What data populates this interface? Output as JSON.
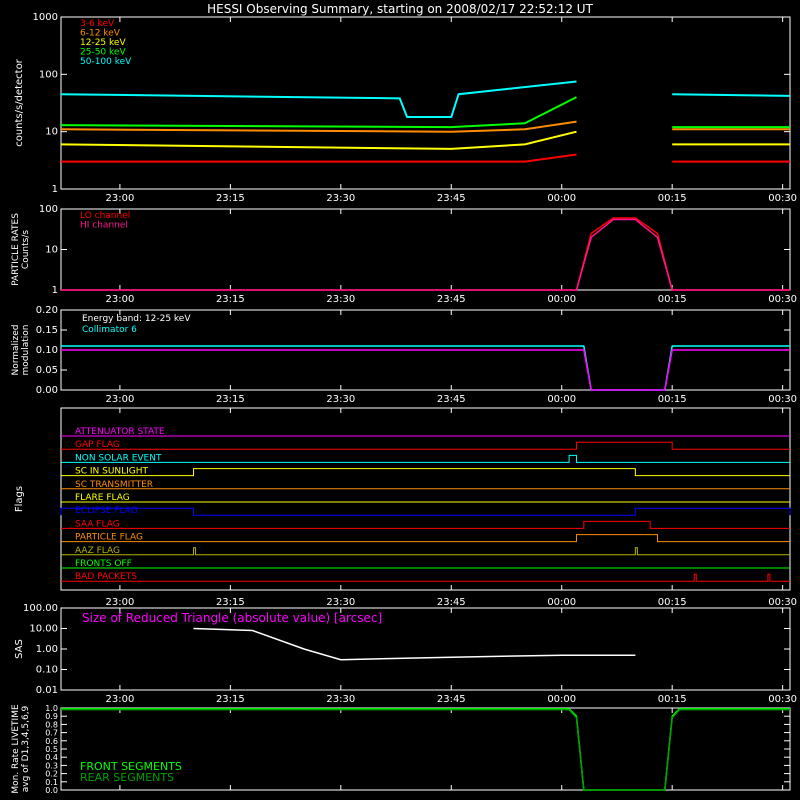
{
  "title": "HESSI Observing Summary, starting on 2008/02/17 22:52:12 UT",
  "x_ticks": [
    "23:00",
    "23:15",
    "23:30",
    "23:45",
    "00:00",
    "00:15",
    "00:30"
  ],
  "colors": {
    "red": "#ff0000",
    "orange": "#ff8c00",
    "yellow": "#ffff00",
    "green": "#00ff00",
    "cyan": "#00ffff",
    "magenta": "#ff00ff",
    "pink": "#ff1493",
    "blue": "#0000ff",
    "olive": "#b5b500",
    "white": "#ffffff",
    "darkgreen": "#00a000"
  },
  "chart_data": [
    {
      "id": "counts",
      "type": "line",
      "ylabel": "counts/s/detector",
      "y_scale": "log",
      "ylim": [
        1,
        1000
      ],
      "y_ticks": [
        "1",
        "10",
        "100",
        "1000"
      ],
      "legend_placement": "top-left",
      "series": [
        {
          "name": "3-6 keV",
          "color": "red",
          "x": [
            "22:52",
            "23:45",
            "23:55",
            "00:02",
            "00:03",
            "00:15",
            "00:31"
          ],
          "y": [
            3,
            3,
            3,
            4,
            null,
            3,
            3
          ]
        },
        {
          "name": "6-12 keV",
          "color": "orange",
          "x": [
            "22:52",
            "23:45",
            "23:55",
            "00:02",
            "00:03",
            "00:15",
            "00:31"
          ],
          "y": [
            11,
            10,
            11,
            15,
            null,
            11,
            11
          ]
        },
        {
          "name": "12-25 keV",
          "color": "yellow",
          "x": [
            "22:52",
            "23:45",
            "23:55",
            "00:02",
            "00:03",
            "00:15",
            "00:31"
          ],
          "y": [
            6,
            5,
            6,
            10,
            null,
            6,
            6
          ]
        },
        {
          "name": "25-50 keV",
          "color": "green",
          "x": [
            "22:52",
            "23:45",
            "23:55",
            "00:02",
            "00:03",
            "00:15",
            "00:31"
          ],
          "y": [
            13,
            12,
            14,
            40,
            null,
            12,
            12
          ]
        },
        {
          "name": "50-100 keV",
          "color": "cyan",
          "x": [
            "22:52",
            "23:38",
            "23:39",
            "23:45",
            "23:46",
            "00:02",
            "00:03",
            "00:15",
            "00:31"
          ],
          "y": [
            45,
            38,
            18,
            18,
            45,
            75,
            null,
            45,
            42
          ]
        }
      ]
    },
    {
      "id": "particle",
      "type": "line",
      "ylabel": "PARTICLE RATES Counts/s",
      "y_scale": "log",
      "ylim": [
        1,
        100
      ],
      "y_ticks": [
        "1",
        "10",
        "100"
      ],
      "legend_placement": "top-left",
      "series": [
        {
          "name": "LO channel",
          "color": "red",
          "x": [
            "22:52",
            "00:02",
            "00:04",
            "00:07",
            "00:10",
            "00:13",
            "00:15",
            "00:31"
          ],
          "y": [
            1,
            1,
            25,
            60,
            60,
            25,
            1,
            1
          ]
        },
        {
          "name": "HI channel",
          "color": "pink",
          "x": [
            "22:52",
            "00:02",
            "00:04",
            "00:07",
            "00:10",
            "00:13",
            "00:15",
            "00:31"
          ],
          "y": [
            1,
            1,
            20,
            55,
            55,
            20,
            1,
            1
          ]
        }
      ]
    },
    {
      "id": "modulation",
      "type": "line",
      "ylabel": "Normalized modulation",
      "y_scale": "linear",
      "ylim": [
        0,
        0.2
      ],
      "y_ticks": [
        "0.00",
        "0.05",
        "0.10",
        "0.15",
        "0.20"
      ],
      "annotations": [
        "Energy band: 12-25 keV",
        "Collimator 6"
      ],
      "series": [
        {
          "name": "Collimator 6",
          "color": "cyan",
          "x": [
            "22:52",
            "00:03",
            "00:04",
            "00:14",
            "00:15",
            "00:31"
          ],
          "y": [
            0.11,
            0.11,
            0,
            0,
            0.11,
            0.11
          ]
        },
        {
          "name": "modulation",
          "color": "magenta",
          "x": [
            "22:52",
            "00:03",
            "00:04",
            "00:14",
            "00:15",
            "00:31"
          ],
          "y": [
            0.1,
            0.1,
            0,
            0,
            0.1,
            0.1
          ]
        }
      ]
    },
    {
      "id": "flags",
      "type": "line",
      "ylabel": "Flags",
      "flags": [
        {
          "name": "ATTENUATOR STATE",
          "color": "magenta",
          "on": []
        },
        {
          "name": "GAP FLAG",
          "color": "red",
          "on": [
            [
              "00:02",
              "00:15"
            ]
          ]
        },
        {
          "name": "NON SOLAR EVENT",
          "color": "cyan",
          "on": [
            [
              "00:01",
              "00:02"
            ]
          ]
        },
        {
          "name": "SC IN SUNLIGHT",
          "color": "yellow",
          "on": [
            [
              "23:10",
              "00:10"
            ]
          ]
        },
        {
          "name": "SC TRANSMITTER",
          "color": "orange",
          "on": []
        },
        {
          "name": "FLARE FLAG",
          "color": "yellow",
          "on": []
        },
        {
          "name": "ECLIPSE FLAG",
          "color": "blue",
          "on": [
            [
              "22:52",
              "23:10"
            ],
            [
              "00:10",
              "00:31"
            ]
          ]
        },
        {
          "name": "SAA FLAG",
          "color": "red",
          "on": [
            [
              "00:03",
              "00:12"
            ]
          ]
        },
        {
          "name": "PARTICLE FLAG",
          "color": "orange",
          "on": [
            [
              "00:02",
              "00:13"
            ]
          ]
        },
        {
          "name": "AAZ FLAG",
          "color": "olive",
          "on": [
            [
              "23:10",
              "23:10"
            ],
            [
              "00:10",
              "00:10"
            ]
          ]
        },
        {
          "name": "FRONTS OFF",
          "color": "green",
          "on": []
        },
        {
          "name": "BAD PACKETS",
          "color": "red",
          "on": [
            [
              "00:18",
              "00:18"
            ],
            [
              "00:28",
              "00:28"
            ]
          ]
        }
      ]
    },
    {
      "id": "sas",
      "type": "line",
      "ylabel": "SAS",
      "y_scale": "log",
      "ylim": [
        0.01,
        100
      ],
      "y_ticks": [
        "0.01",
        "0.10",
        "1.00",
        "10.00",
        "100.00"
      ],
      "annotations": [
        "Size of Reduced Triangle (absolute value) [arcsec]"
      ],
      "series": [
        {
          "name": "Size of Reduced Triangle",
          "color": "white",
          "x": [
            "23:10",
            "23:18",
            "23:25",
            "23:30",
            "23:45",
            "00:00",
            "00:10"
          ],
          "y": [
            10,
            8,
            1,
            0.3,
            0.4,
            0.5,
            0.5
          ]
        }
      ]
    },
    {
      "id": "livetime",
      "type": "line",
      "ylabel": "Mon. Rate LIVETIME avg of D1,3,4,5,6,9",
      "y_scale": "linear",
      "ylim": [
        0,
        1
      ],
      "y_ticks": [
        "0.0",
        "0.1",
        "0.2",
        "0.3",
        "0.4",
        "0.5",
        "0.6",
        "0.7",
        "0.8",
        "0.9",
        "1.0"
      ],
      "legend_placement": "bottom-left",
      "series": [
        {
          "name": "FRONT SEGMENTS",
          "color": "green",
          "x": [
            "22:52",
            "00:01",
            "00:02",
            "00:03",
            "00:14",
            "00:15",
            "00:16",
            "00:31"
          ],
          "y": [
            0.99,
            0.99,
            0.9,
            0,
            0,
            0.9,
            0.99,
            0.99
          ]
        },
        {
          "name": "REAR SEGMENTS",
          "color": "darkgreen",
          "x": [
            "22:52",
            "00:01",
            "00:02",
            "00:03",
            "00:14",
            "00:15",
            "00:16",
            "00:31"
          ],
          "y": [
            0.98,
            0.98,
            0.88,
            0,
            0,
            0.88,
            0.98,
            0.98
          ]
        }
      ]
    }
  ]
}
